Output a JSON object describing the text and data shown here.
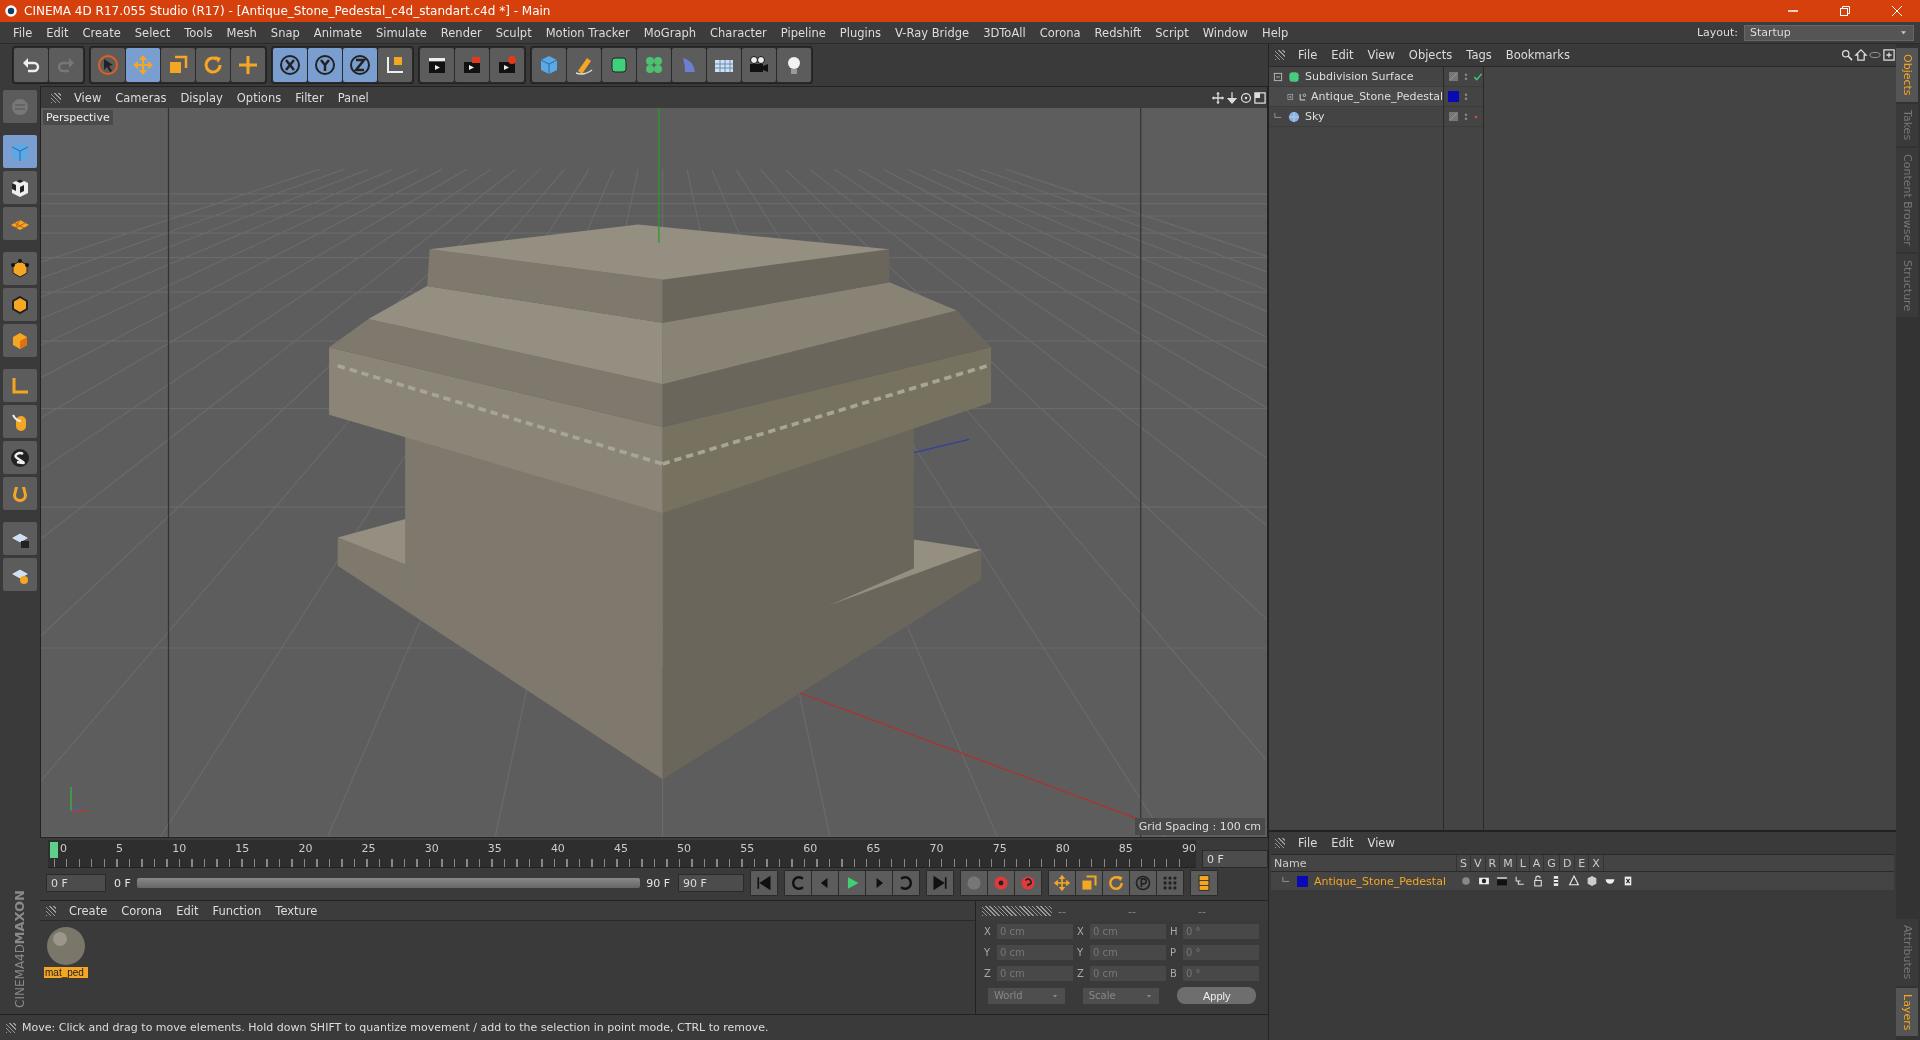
{
  "window": {
    "title": "CINEMA 4D R17.055 Studio (R17) - [Antique_Stone_Pedestal_c4d_standart.c4d *] - Main"
  },
  "menu": [
    "File",
    "Edit",
    "Create",
    "Select",
    "Tools",
    "Mesh",
    "Snap",
    "Animate",
    "Simulate",
    "Render",
    "Sculpt",
    "Motion Tracker",
    "MoGraph",
    "Character",
    "Pipeline",
    "Plugins",
    "V-Ray Bridge",
    "3DToAll",
    "Corona",
    "Redshift",
    "Script",
    "Window",
    "Help"
  ],
  "layout": {
    "label": "Layout:",
    "value": "Startup"
  },
  "toolbar": [
    {
      "kind": "undo",
      "selected": false
    },
    {
      "kind": "redo",
      "selected": false
    },
    {
      "kind": "select",
      "selected": false
    },
    {
      "kind": "move",
      "selected": true
    },
    {
      "kind": "scale",
      "selected": false
    },
    {
      "kind": "rotate",
      "selected": false
    },
    {
      "kind": "transform",
      "selected": false
    },
    {
      "kind": "axis-x",
      "selected": true
    },
    {
      "kind": "axis-y",
      "selected": true
    },
    {
      "kind": "axis-z",
      "selected": true
    },
    {
      "kind": "coords",
      "selected": false
    },
    {
      "kind": "render",
      "selected": false
    },
    {
      "kind": "render-view",
      "selected": false
    },
    {
      "kind": "render-settings",
      "selected": false
    },
    {
      "kind": "cube",
      "selected": false
    },
    {
      "kind": "pen",
      "selected": false
    },
    {
      "kind": "subdiv",
      "selected": false
    },
    {
      "kind": "cloner",
      "selected": false
    },
    {
      "kind": "deformer",
      "selected": false
    },
    {
      "kind": "floor",
      "selected": false
    },
    {
      "kind": "camera",
      "selected": false
    },
    {
      "kind": "light",
      "selected": false
    }
  ],
  "left_tools": [
    {
      "kind": "model",
      "selected": false
    },
    {
      "kind": "cube",
      "selected": true
    },
    {
      "kind": "texture",
      "selected": false
    },
    {
      "kind": "workplane",
      "selected": false
    },
    {
      "kind": "points",
      "selected": false
    },
    {
      "kind": "edges",
      "selected": false
    },
    {
      "kind": "polygons",
      "selected": false
    },
    {
      "kind": "axis",
      "selected": false
    },
    {
      "kind": "tweak",
      "selected": false
    },
    {
      "kind": "snap",
      "selected": false
    },
    {
      "kind": "magnet",
      "selected": false
    },
    {
      "kind": "lock",
      "selected": false
    },
    {
      "kind": "grid",
      "selected": false
    }
  ],
  "viewport": {
    "menu": [
      "View",
      "Cameras",
      "Display",
      "Options",
      "Filter",
      "Panel"
    ],
    "camera": "Perspective",
    "grid_spacing": "Grid Spacing : 100 cm"
  },
  "timeline": {
    "ticks": [
      "0",
      "5",
      "10",
      "15",
      "20",
      "25",
      "30",
      "35",
      "40",
      "45",
      "50",
      "55",
      "60",
      "65",
      "70",
      "75",
      "80",
      "85",
      "90"
    ],
    "current": "0 F",
    "start": "0 F",
    "range_start": "0 F",
    "range_end": "90 F",
    "level": 1,
    "end": "90 F"
  },
  "materials": {
    "menu": [
      "Create",
      "Corona",
      "Edit",
      "Function",
      "Texture"
    ],
    "items": [
      {
        "name": "mat_ped",
        "selected": true
      }
    ]
  },
  "coordinates": {
    "headers": [
      "--",
      "--",
      "--"
    ],
    "rows": [
      {
        "axis": "X",
        "position": "0 cm",
        "axis2": "X",
        "size": "0 cm",
        "rot_axis": "H",
        "rotation": "0 °"
      },
      {
        "axis": "Y",
        "position": "0 cm",
        "axis2": "Y",
        "size": "0 cm",
        "rot_axis": "P",
        "rotation": "0 °"
      },
      {
        "axis": "Z",
        "position": "0 cm",
        "axis2": "Z",
        "size": "0 cm",
        "rot_axis": "B",
        "rotation": "0 °"
      }
    ],
    "space": "World",
    "mode": "Scale",
    "apply": "Apply"
  },
  "status_bar": "Move: Click and drag to move elements. Hold down SHIFT to quantize movement / add to the selection in point mode, CTRL to remove.",
  "logo": {
    "brand": "MAXON",
    "product": "CINEMA4D"
  },
  "objects": {
    "menu": [
      "File",
      "Edit",
      "View",
      "Objects",
      "Tags",
      "Bookmarks"
    ],
    "tree": [
      {
        "name": "Subdivision Surface",
        "kind": "subdiv",
        "enabled": true,
        "expanded": true,
        "children": [
          {
            "name": "Antique_Stone_Pedestal",
            "kind": "null",
            "color": "#0a0ab4",
            "expanded": false
          }
        ]
      },
      {
        "name": "Sky",
        "kind": "sky",
        "enabled": false
      }
    ]
  },
  "layers": {
    "menu": [
      "File",
      "Edit",
      "View"
    ],
    "columns": [
      "Name",
      "S",
      "V",
      "R",
      "M",
      "L",
      "A",
      "G",
      "D",
      "E",
      "X"
    ],
    "rows": [
      {
        "name": "Antique_Stone_Pedestal",
        "color": "#0a0ab4"
      }
    ]
  },
  "side_tabs": [
    {
      "label": "Objects",
      "selected": true
    },
    {
      "label": "Takes",
      "selected": false
    },
    {
      "label": "Content Browser",
      "selected": false
    },
    {
      "label": "Structure",
      "selected": false
    }
  ],
  "side_tabs_bottom": [
    {
      "label": "Attributes",
      "selected": false
    },
    {
      "label": "Layers",
      "selected": true
    }
  ]
}
